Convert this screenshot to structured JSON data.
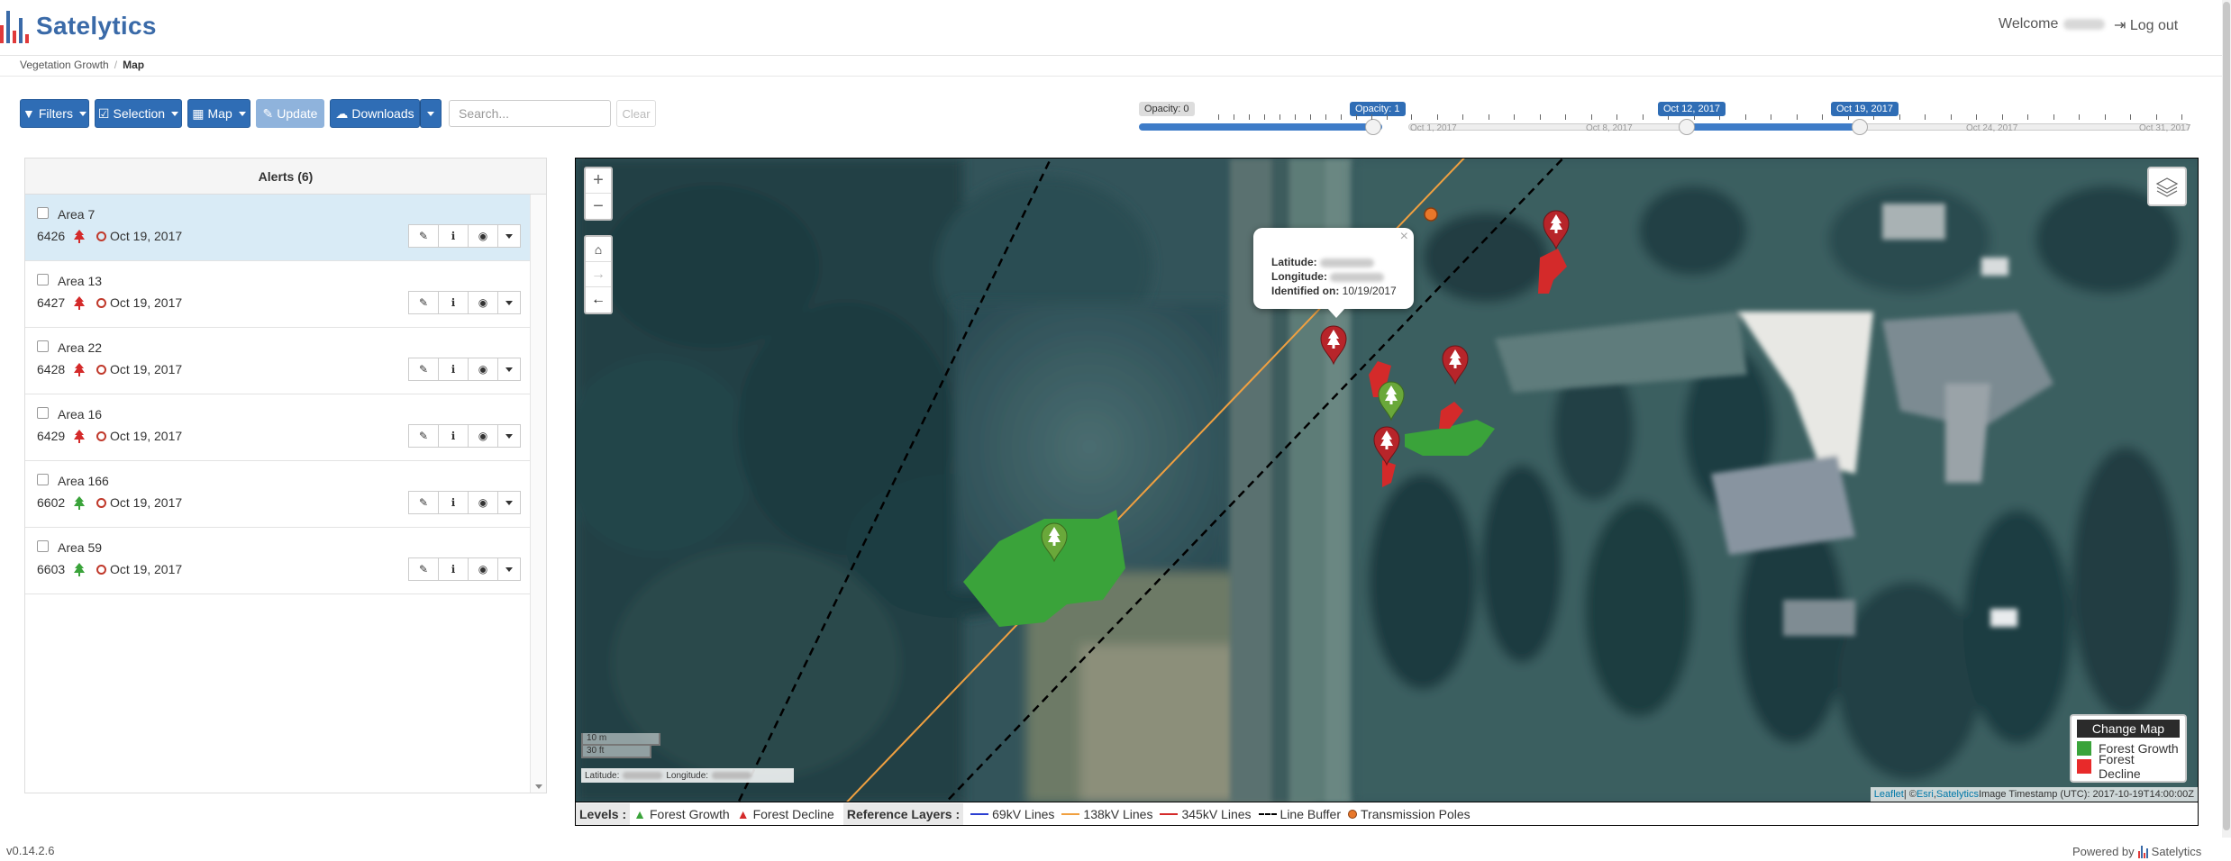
{
  "app": {
    "name": "Satelytics",
    "welcome": "Welcome",
    "logout": "Log out",
    "version": "v0.14.2.6",
    "powered_by": "Powered by",
    "powered_brand": "Satelytics"
  },
  "breadcrumb": {
    "parent": "Vegetation Growth",
    "current": "Map"
  },
  "toolbar": {
    "filters": "Filters",
    "selection": "Selection",
    "map": "Map",
    "update": "Update",
    "downloads": "Downloads",
    "search_placeholder": "Search...",
    "clear": "Clear"
  },
  "opacity_slider": {
    "min_label": "Opacity: 0",
    "value_label": "Opacity: 1",
    "value": 1
  },
  "date_slider": {
    "ticks": [
      "Oct 1, 2017",
      "Oct 8, 2017",
      "Oct 24, 2017",
      "Oct 31, 2017"
    ],
    "from_label": "Oct 12, 2017",
    "to_label": "Oct 19, 2017"
  },
  "alerts": {
    "title": "Alerts (6)",
    "items": [
      {
        "area": "Area 7",
        "id": "6426",
        "type": "decline",
        "date": "Oct 19, 2017",
        "selected": true
      },
      {
        "area": "Area 13",
        "id": "6427",
        "type": "decline",
        "date": "Oct 19, 2017",
        "selected": false
      },
      {
        "area": "Area 22",
        "id": "6428",
        "type": "decline",
        "date": "Oct 19, 2017",
        "selected": false
      },
      {
        "area": "Area 16",
        "id": "6429",
        "type": "decline",
        "date": "Oct 19, 2017",
        "selected": false
      },
      {
        "area": "Area 166",
        "id": "6602",
        "type": "growth",
        "date": "Oct 19, 2017",
        "selected": false
      },
      {
        "area": "Area 59",
        "id": "6603",
        "type": "growth",
        "date": "Oct 19, 2017",
        "selected": false
      }
    ]
  },
  "map": {
    "popup": {
      "lat_label": "Latitude:",
      "lon_label": "Longitude:",
      "id_label": "Identified on:",
      "id_value": "10/19/2017"
    },
    "scale": {
      "metric": "10 m",
      "imperial": "30 ft"
    },
    "coords": {
      "lat_label": "Latitude:",
      "lon_label": "Longitude:"
    },
    "legend": {
      "title": "Change Map",
      "growth": "Forest Growth",
      "decline": "Forest Decline"
    },
    "attribution": {
      "leaflet": "Leaflet",
      "sep1": " | © ",
      "esri": "Esri",
      "sep2": ", ",
      "satelytics": "Satelytics",
      "timestamp": " Image Timestamp (UTC): 2017-10-19T14:00:00Z"
    }
  },
  "levels": {
    "label": "Levels :",
    "growth": "Forest Growth",
    "decline": "Forest Decline",
    "ref_label": "Reference Layers :",
    "l69": "69kV Lines",
    "l138": "138kV Lines",
    "l345": "345kV Lines",
    "buffer": "Line Buffer",
    "poles": "Transmission Poles"
  },
  "colors": {
    "primary": "#2f6db5",
    "growth": "#3aa33a",
    "decline": "#d42a2a",
    "line69": "#2b3fd1",
    "line138": "#f0a040",
    "line345": "#d42a2a",
    "pole": "#e8772a"
  },
  "icons": {
    "tree": "tree-icon",
    "pencil": "pencil-icon",
    "info": "info-icon",
    "eye": "eye-icon",
    "home": "home-icon",
    "layers": "layers-icon"
  }
}
